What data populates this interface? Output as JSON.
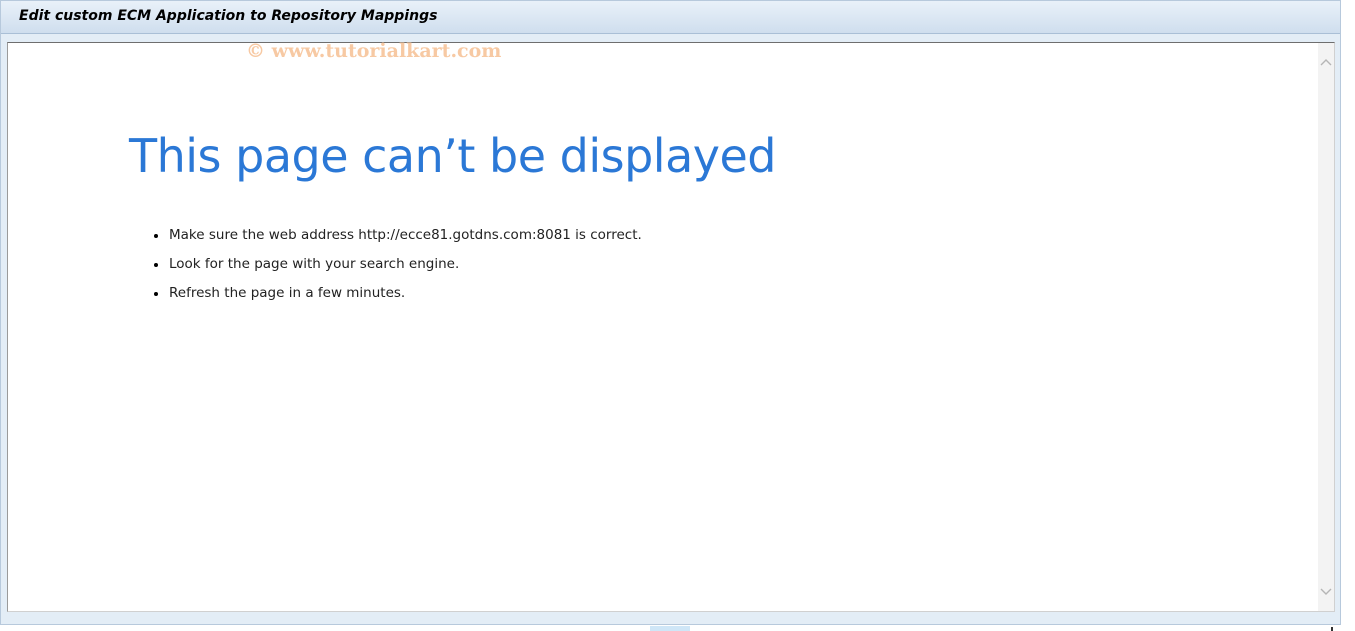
{
  "window": {
    "title": "Edit custom ECM Application to Repository Mappings"
  },
  "watermark": {
    "text": "© www.tutorialkart.com"
  },
  "error_page": {
    "heading": "This page can’t be displayed",
    "suggestions": [
      "Make sure the web address http://ecce81.gotdns.com:8081 is correct.",
      "Look for the page with your search engine.",
      "Refresh the page in a few minutes."
    ]
  },
  "colors": {
    "heading": "#2b78d6",
    "watermark": "#f7c9a3",
    "title_bar": "#cfdeee"
  },
  "icons": {
    "scroll_up": "chevron-up-icon",
    "scroll_down": "chevron-down-icon"
  }
}
